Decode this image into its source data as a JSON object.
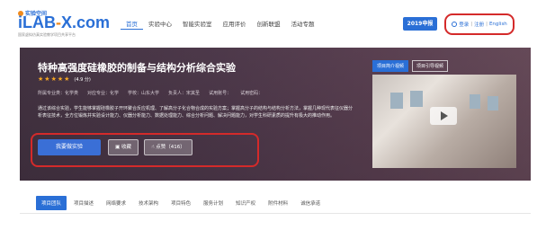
{
  "header": {
    "logo_top": "实验空间",
    "logo_main_a": "iLAB",
    "logo_main_dash": "-",
    "logo_main_b": "X.com",
    "logo_sub": "国家虚拟仿真实验教学项目共享平台",
    "nav": [
      "首页",
      "实验中心",
      "智能实验室",
      "应用评价",
      "创新联盟",
      "活动专题"
    ],
    "year_button": "2019申报",
    "login": "登录",
    "register": "注册",
    "english": "English"
  },
  "project": {
    "title": "特种高强度硅橡胶的制备与结构分析综合实验",
    "stars": [
      "★",
      "★",
      "★",
      "★",
      "★"
    ],
    "score": "(4.9 分)",
    "meta": [
      "所属专业类：化学类",
      "对应专业：化学",
      "学校：山东大学",
      "负责人：宋其圣",
      "试用账号：",
      "试用密码："
    ],
    "description": "通过该综合实验，学生能够掌握硅橡胶子开环聚合反应机理、了解高分子化合物合成的实验方案；掌握高分子的结构与结构分析方法，掌握几种现代表征仪器分析表征技术，全方位锻炼并实验设计能力、仪器分析能力、数据处理能力、综合分析问题、解决问题能力，对学生科研素质的提升有极大的推动作用。",
    "btn_start": "我要做实验",
    "btn_fav": "收藏",
    "btn_like": "点赞（416）"
  },
  "media": {
    "tabs": [
      "项目简介视频",
      "项目引导视频"
    ]
  },
  "tabs": [
    "项目团队",
    "项目描述",
    "网络要求",
    "技术架构",
    "项目特色",
    "服务计划",
    "知识产权",
    "附件材料",
    "诚信承诺"
  ],
  "colors": {
    "accent": "#2a6fd6",
    "highlight": "#d42a2a",
    "star": "#f5a623"
  }
}
